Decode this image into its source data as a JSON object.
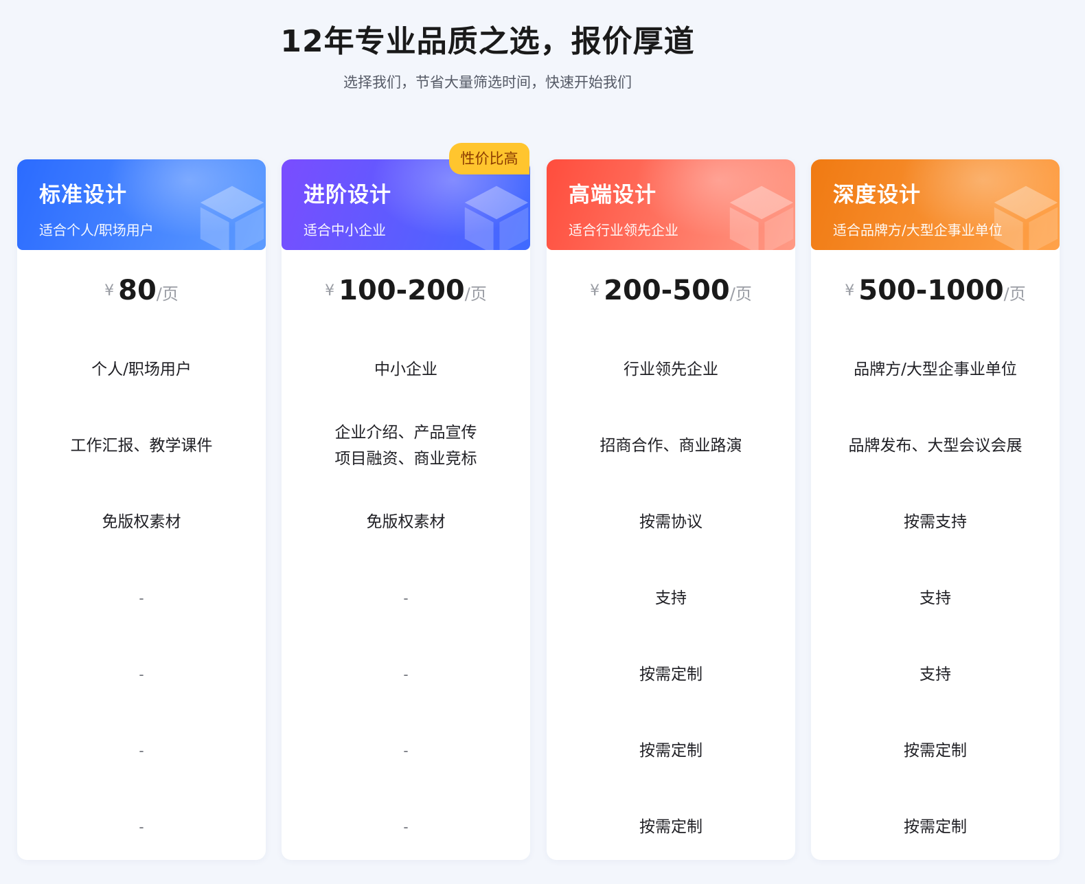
{
  "hero": {
    "title": "12年专业品质之选，报价厚道",
    "subtitle": "选择我们，节省大量筛选时间，快速开始我们"
  },
  "badge": {
    "label": "性价比高"
  },
  "colors": {
    "standard": [
      "#2b6bff",
      "#5d9bff"
    ],
    "advanced": [
      "#7a4dff",
      "#3f6bff"
    ],
    "premium": [
      "#ff4d3d",
      "#ff9a85"
    ],
    "deep": [
      "#f07a12",
      "#ffa24a"
    ]
  },
  "plans": [
    {
      "title": "标准设计",
      "desc": "适合个人/职场用户",
      "currency": "¥",
      "price": "80",
      "unit": "/页",
      "rows": [
        "个人/职场用户",
        "工作汇报、教学课件",
        "免版权素材",
        "-",
        "-",
        "-",
        "-"
      ]
    },
    {
      "title": "进阶设计",
      "desc": "适合中小企业",
      "currency": "¥",
      "price": "100-200",
      "unit": "/页",
      "rows": [
        "中小企业",
        "企业介绍、产品宣传",
        "项目融资、商业竞标",
        "免版权素材",
        "-",
        "-",
        "-",
        "-"
      ]
    },
    {
      "title": "高端设计",
      "desc": "适合行业领先企业",
      "currency": "¥",
      "price": "200-500",
      "unit": "/页",
      "rows": [
        "行业领先企业",
        "招商合作、商业路演",
        "按需协议",
        "支持",
        "按需定制",
        "按需定制",
        "按需定制"
      ]
    },
    {
      "title": "深度设计",
      "desc": "适合品牌方/大型企事业单位",
      "currency": "¥",
      "price": "500-1000",
      "unit": "/页",
      "rows": [
        "品牌方/大型企事业单位",
        "品牌发布、大型会议会展",
        "按需支持",
        "支持",
        "支持",
        "按需定制",
        "按需定制"
      ]
    }
  ]
}
